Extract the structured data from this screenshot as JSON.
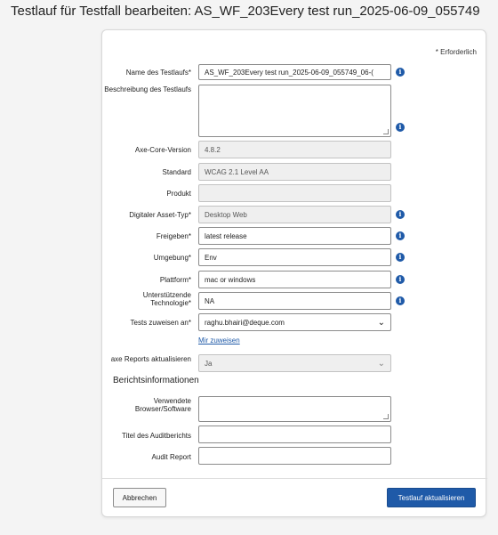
{
  "page": {
    "title": "Testlauf für Testfall bearbeiten: AS_WF_203Every test run_2025-06-09_055749"
  },
  "form": {
    "required_note": "* Erforderlich",
    "fields": {
      "name": {
        "label": "Name des Testlaufs*",
        "value": "AS_WF_203Every test run_2025-06-09_055749_06-("
      },
      "description": {
        "label": "Beschreibung des Testlaufs",
        "value": ""
      },
      "axe_core": {
        "label": "Axe-Core-Version",
        "value": "4.8.2"
      },
      "standard": {
        "label": "Standard",
        "value": "WCAG 2.1 Level AA"
      },
      "product": {
        "label": "Produkt",
        "value": ""
      },
      "asset_type": {
        "label": "Digitaler Asset-Typ*",
        "value": "Desktop Web"
      },
      "release": {
        "label": "Freigeben*",
        "value": "latest release"
      },
      "environment": {
        "label": "Umgebung*",
        "value": "Env"
      },
      "platform": {
        "label": "Plattform*",
        "value": "mac or windows"
      },
      "assistive_tech": {
        "label": "Unterstützende Technologie*",
        "value": "NA"
      },
      "assign_tests": {
        "label": "Tests zuweisen an*",
        "value": "raghu.bhairi@deque.com"
      },
      "assign_me_link": "Mir zuweisen",
      "axe_reports": {
        "label": "axe Reports aktualisieren",
        "value": "Ja"
      }
    },
    "report_section": {
      "title": "Berichtsinformationen",
      "browsers": {
        "label": "Verwendete Browser/Software",
        "value": ""
      },
      "audit_title": {
        "label": "Titel des Auditberichts",
        "value": ""
      },
      "audit_report": {
        "label": "Audit Report",
        "value": ""
      }
    },
    "buttons": {
      "cancel": "Abbrechen",
      "submit": "Testlauf aktualisieren"
    }
  },
  "icons": {
    "info": "info-icon",
    "chevron": "chevron-down-icon"
  },
  "colors": {
    "accent": "#1f5aa8",
    "disabled_bg": "#efefef"
  }
}
